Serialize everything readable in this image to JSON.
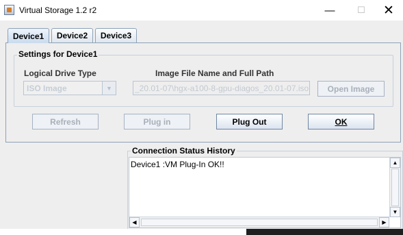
{
  "window": {
    "title": "Virtual Storage 1.2 r2",
    "minimize_symbol": "—",
    "maximize_symbol": "☐",
    "close_symbol": "✕"
  },
  "tabs": [
    {
      "label": "Device1",
      "active": true
    },
    {
      "label": "Device2",
      "active": false
    },
    {
      "label": "Device3",
      "active": false
    }
  ],
  "settings": {
    "legend": "Settings for Device1",
    "drive_type_label": "Logical Drive Type",
    "drive_type_value": "ISO Image",
    "path_label": "Image File Name and Full Path",
    "path_value": "_20.01-07\\hgx-a100-8-gpu-diagos_20.01-07.iso",
    "open_image_label": "Open Image"
  },
  "actions": {
    "refresh_label": "Refresh",
    "plugin_label": "Plug in",
    "plugout_label": "Plug Out",
    "ok_label": "OK"
  },
  "history": {
    "legend": "Connection Status History",
    "lines": [
      "Device1 :VM Plug-In OK!!"
    ]
  },
  "icons": {
    "app": "app-icon",
    "combo_arrow": "chevron-down-icon",
    "scroll_up": "arrow-up-icon",
    "scroll_down": "arrow-down-icon",
    "scroll_left": "arrow-left-icon",
    "scroll_right": "arrow-right-icon"
  },
  "colors": {
    "tab_border": "#8da2b8",
    "disabled_text": "#a8b0ba",
    "panel_bg": "#eeeeee"
  }
}
